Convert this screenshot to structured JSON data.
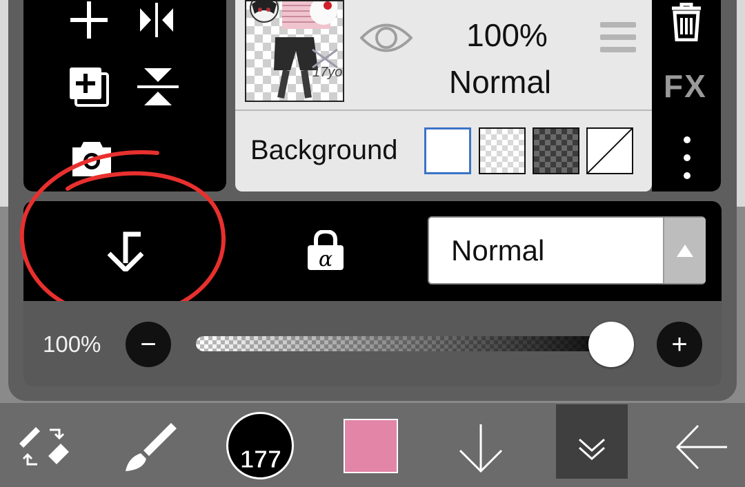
{
  "layer": {
    "opacity": "100%",
    "blend_mode": "Normal",
    "background_label": "Background",
    "thumbnail_text": "17yo"
  },
  "right_strip": {
    "fx_label": "FX"
  },
  "action_bar": {
    "blend_select_value": "Normal"
  },
  "opacity_row": {
    "label": "100%",
    "value_percent": 100,
    "minus_symbol": "−",
    "plus_symbol": "+"
  },
  "bottom_bar": {
    "brush_size": "177",
    "current_color": "#e285a6"
  },
  "colors": {
    "annotation_red": "#e8302e",
    "selected_blue": "#3a73c8"
  }
}
